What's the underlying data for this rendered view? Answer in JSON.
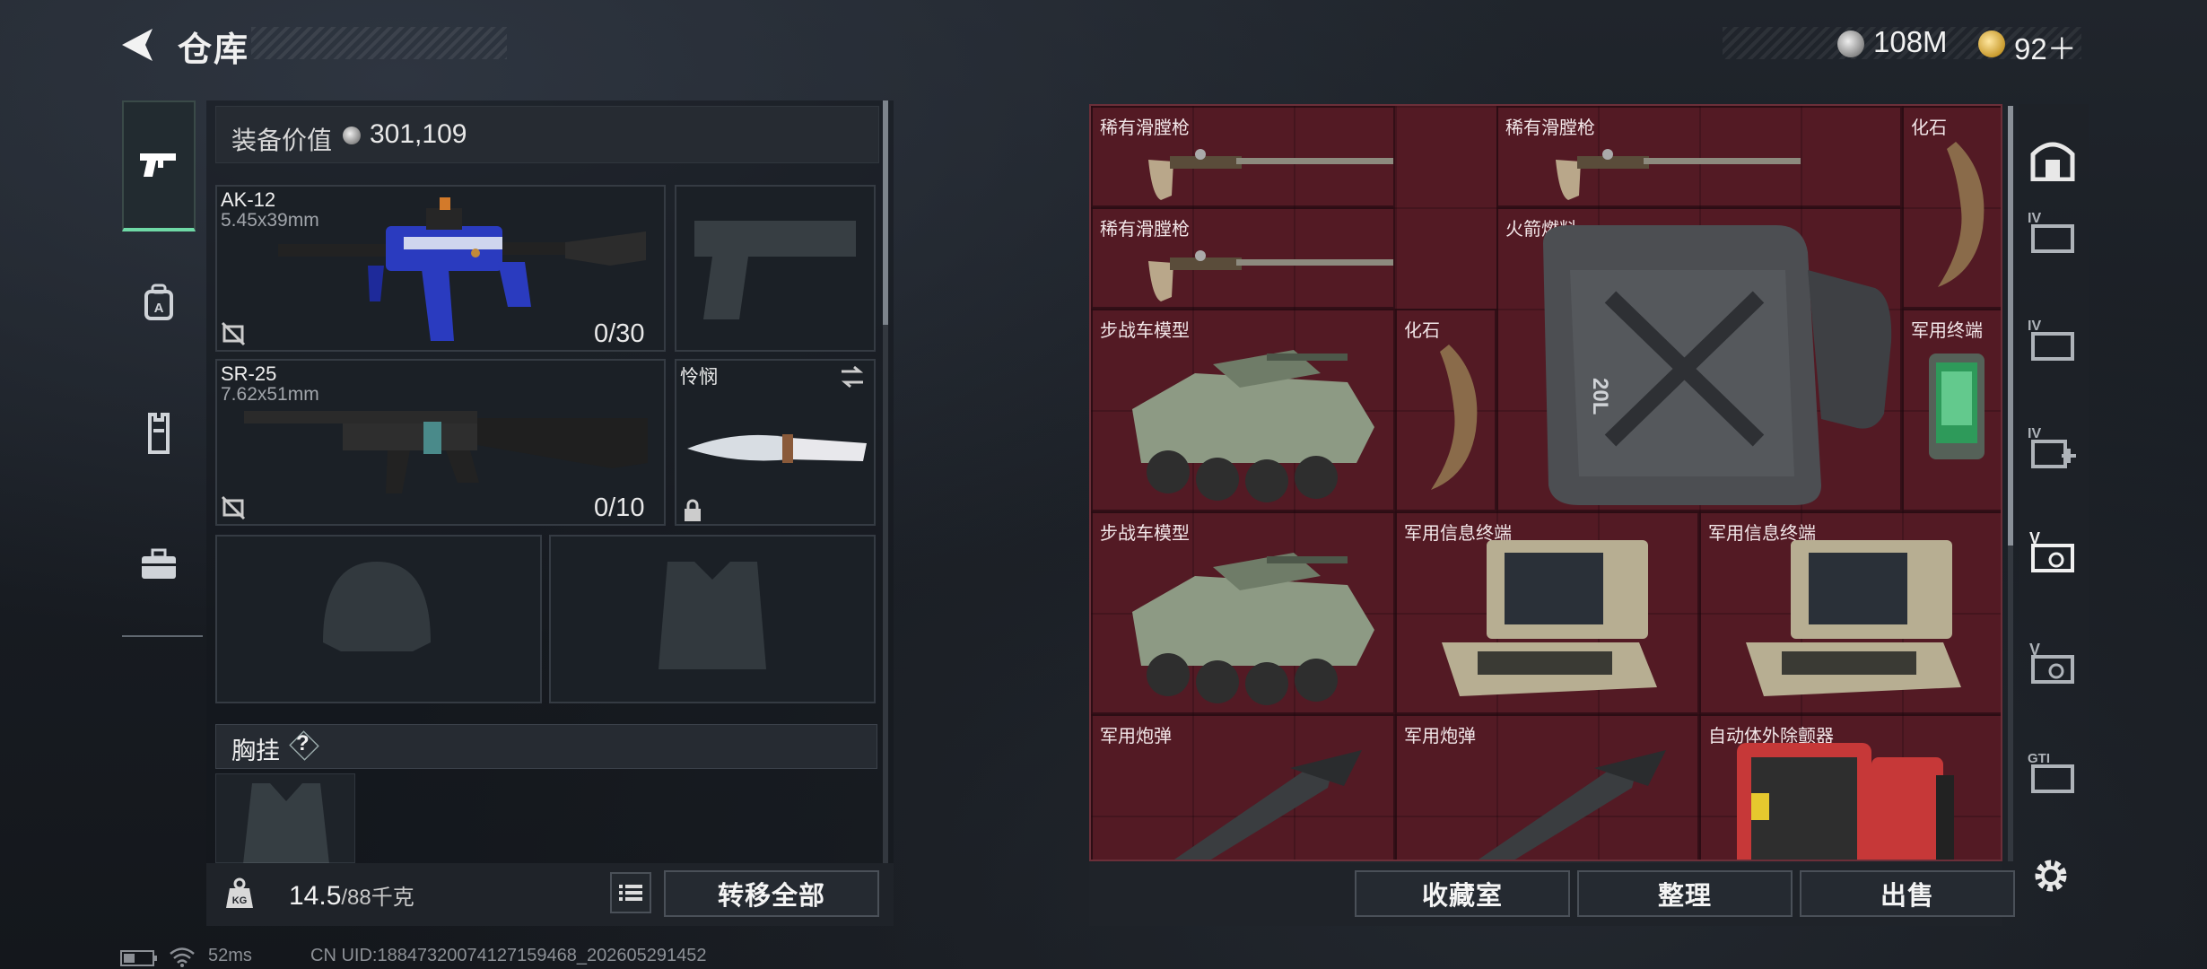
{
  "header": {
    "title": "仓库",
    "currency_silver": "108M",
    "currency_gold": "92＋"
  },
  "left_tabs": [
    {
      "name": "weapon-tab-icon",
      "active": true
    },
    {
      "name": "backpack-tab-icon",
      "active": false
    },
    {
      "name": "armor-tab-icon",
      "active": false
    },
    {
      "name": "toolbox-tab-icon",
      "active": false
    }
  ],
  "equipment": {
    "value_label": "装备价值",
    "value": "301,109",
    "primary": {
      "name": "AK-12",
      "caliber": "5.45x39mm",
      "ammo": "0/30"
    },
    "secondary": {
      "name": "SR-25",
      "caliber": "7.62x51mm",
      "ammo": "0/10"
    },
    "melee": {
      "name": "怜悯"
    },
    "chest_label": "胸挂",
    "chest_help": "?"
  },
  "left_footer": {
    "weight": "14.5",
    "weight_max": "/88千克",
    "transfer_all": "转移全部"
  },
  "storage": {
    "items": [
      {
        "label": "稀有滑膛枪",
        "icon": "musket"
      },
      {
        "label": "稀有滑膛枪",
        "icon": "musket"
      },
      {
        "label": "化石",
        "icon": "fossil-claw"
      },
      {
        "label": "稀有滑膛枪",
        "icon": "musket"
      },
      {
        "label": "火箭燃料",
        "icon": "fuel-canister"
      },
      {
        "label": "步战车模型",
        "icon": "ifv-model"
      },
      {
        "label": "化石",
        "icon": "fossil-claw"
      },
      {
        "label": "军用终端",
        "icon": "military-terminal"
      },
      {
        "label": "步战车模型",
        "icon": "ifv-model"
      },
      {
        "label": "军用信息终端",
        "icon": "info-terminal"
      },
      {
        "label": "军用信息终端",
        "icon": "info-terminal"
      },
      {
        "label": "军用炮弹",
        "icon": "artillery-shell"
      },
      {
        "label": "军用炮弹",
        "icon": "artillery-shell"
      },
      {
        "label": "自动体外除颤器",
        "icon": "defibrillator"
      }
    ],
    "fuel_can_text": "20L"
  },
  "storage_footer": {
    "collection": "收藏室",
    "organize": "整理",
    "sell": "出售"
  },
  "right_tabs": [
    {
      "name": "safe-house-icon",
      "label": ""
    },
    {
      "name": "case-tier4-icon",
      "label": "IV"
    },
    {
      "name": "case-tier4-b-icon",
      "label": "IV"
    },
    {
      "name": "case-tier4-plus-icon",
      "label": "IV"
    },
    {
      "name": "case-tier5-icon",
      "label": "V"
    },
    {
      "name": "case-tier5-b-icon",
      "label": "V"
    },
    {
      "name": "case-gti-icon",
      "label": "GTI"
    }
  ],
  "status": {
    "ping": "52ms",
    "uid": "CN UID:18847320074127159468_202605291452"
  },
  "colors": {
    "storage_bg": "#531a24",
    "active_tab_accent": "#6fd9a6"
  }
}
